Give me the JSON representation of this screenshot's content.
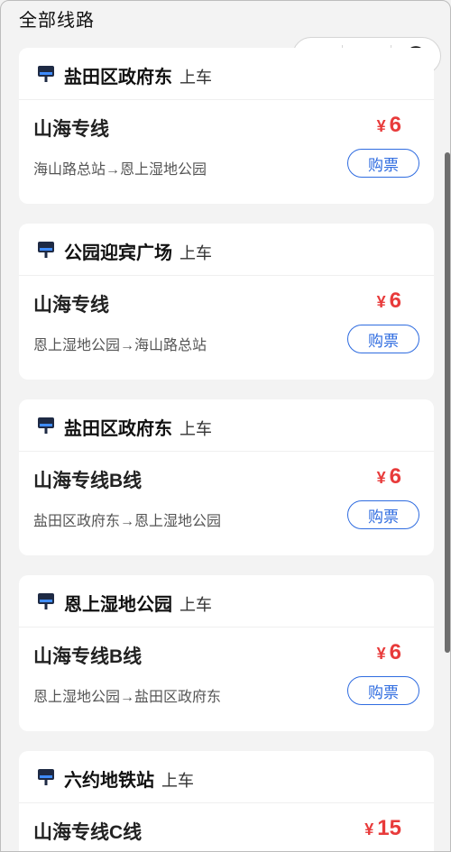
{
  "header": {
    "title": "全部线路"
  },
  "capsule": {
    "menu_icon": "more-dots-icon",
    "minimize_icon": "minimize-icon",
    "close_icon": "target-icon"
  },
  "colors": {
    "price": "#e83b3b",
    "accent": "#2f6ce0"
  },
  "cards": [
    {
      "stop": "盐田区政府东",
      "board": "上车",
      "route": "山海专线",
      "currency": "¥",
      "price": "6",
      "direction": "海山路总站→恩上湿地公园",
      "buy": "购票"
    },
    {
      "stop": "公园迎宾广场",
      "board": "上车",
      "route": "山海专线",
      "currency": "¥",
      "price": "6",
      "direction": "恩上湿地公园→海山路总站",
      "buy": "购票"
    },
    {
      "stop": "盐田区政府东",
      "board": "上车",
      "route": "山海专线B线",
      "currency": "¥",
      "price": "6",
      "direction": "盐田区政府东→恩上湿地公园",
      "buy": "购票"
    },
    {
      "stop": "恩上湿地公园",
      "board": "上车",
      "route": "山海专线B线",
      "currency": "¥",
      "price": "6",
      "direction": "恩上湿地公园→盐田区政府东",
      "buy": "购票"
    },
    {
      "stop": "六约地铁站",
      "board": "上车",
      "route": "山海专线C线",
      "currency": "¥",
      "price": "15",
      "direction": "",
      "buy": ""
    }
  ]
}
